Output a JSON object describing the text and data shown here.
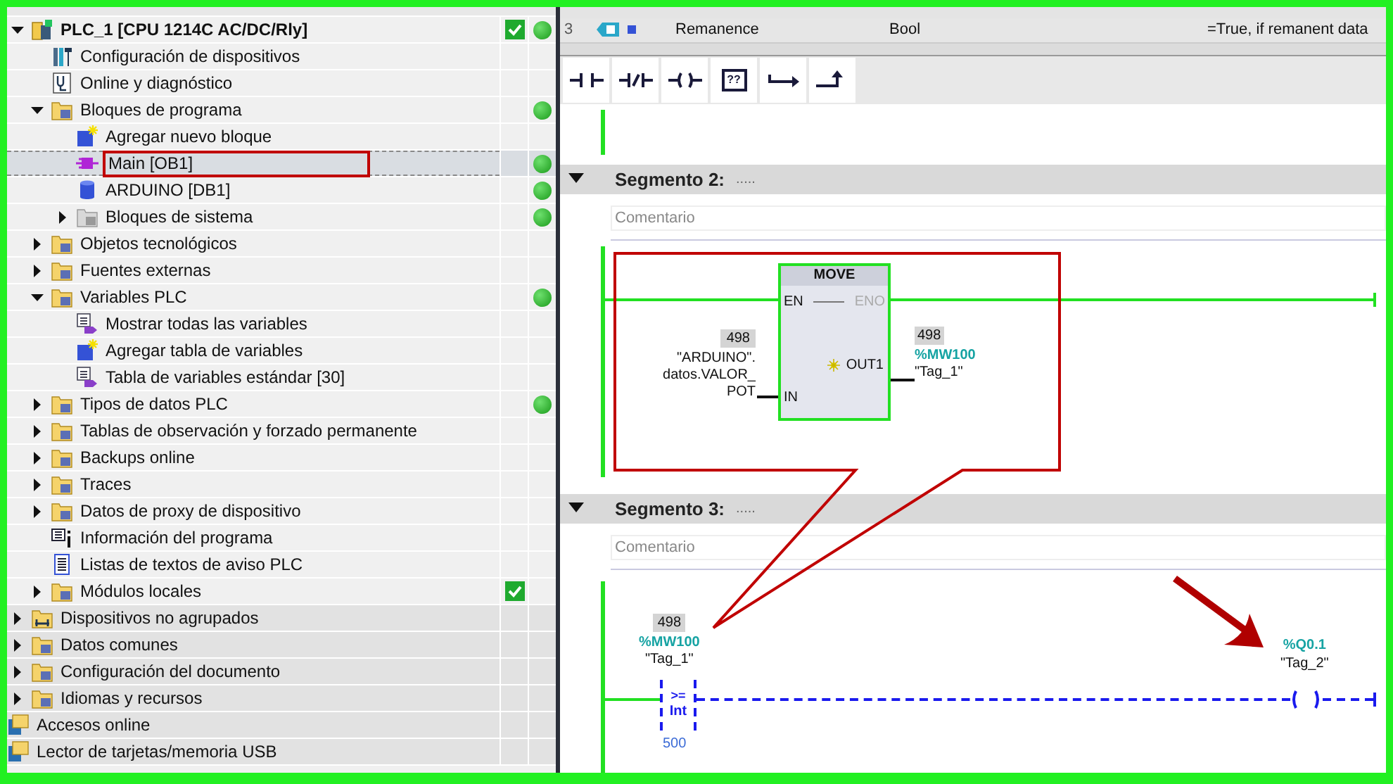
{
  "project_tree": [
    {
      "label": "PLC_1 [CPU 1214C AC/DC/Rly]",
      "kind": "device",
      "expanded": true,
      "selected": false,
      "ok": true,
      "online": true,
      "children": [
        {
          "label": "Configuración de dispositivos",
          "kind": "config",
          "selected": false
        },
        {
          "label": "Online y diagnóstico",
          "kind": "diagnostic",
          "selected": false
        },
        {
          "label": "Bloques de programa",
          "kind": "folder",
          "expanded": true,
          "selected": false,
          "online": true,
          "children": [
            {
              "label": "Agregar nuevo bloque",
              "kind": "add",
              "selected": false
            },
            {
              "label": "Main [OB1]",
              "kind": "block",
              "selected": true,
              "online": true
            },
            {
              "label": "ARDUINO [DB1]",
              "kind": "database",
              "selected": false,
              "online": true
            },
            {
              "label": "Bloques de sistema",
              "kind": "greyfolder",
              "expanded": false,
              "selected": false,
              "online": true
            }
          ]
        },
        {
          "label": "Objetos tecnológicos",
          "kind": "folder",
          "expanded": false,
          "selected": false
        },
        {
          "label": "Fuentes externas",
          "kind": "folder",
          "expanded": false,
          "selected": false
        },
        {
          "label": "Variables PLC",
          "kind": "folder",
          "expanded": true,
          "selected": false,
          "online": true,
          "children": [
            {
              "label": "Mostrar todas las variables",
              "kind": "tags",
              "selected": false
            },
            {
              "label": "Agregar tabla de variables",
              "kind": "add",
              "selected": false
            },
            {
              "label": "Tabla de variables estándar [30]",
              "kind": "tags",
              "selected": false
            }
          ]
        },
        {
          "label": "Tipos de datos PLC",
          "kind": "folder",
          "expanded": false,
          "selected": false,
          "online": true
        },
        {
          "label": "Tablas de observación y forzado permanente",
          "kind": "folder",
          "expanded": false,
          "selected": false
        },
        {
          "label": "Backups online",
          "kind": "folder",
          "expanded": false,
          "selected": false
        },
        {
          "label": "Traces",
          "kind": "folder",
          "expanded": false,
          "selected": false
        },
        {
          "label": "Datos de proxy de dispositivo",
          "kind": "folder",
          "expanded": false,
          "selected": false
        },
        {
          "label": "Información del programa",
          "kind": "info",
          "selected": false
        },
        {
          "label": "Listas de textos de aviso PLC",
          "kind": "textlist",
          "selected": false
        },
        {
          "label": "Módulos locales",
          "kind": "folder",
          "expanded": false,
          "selected": false,
          "ok": true
        }
      ]
    },
    {
      "label": "Dispositivos no agrupados",
      "kind": "network",
      "expanded": false,
      "selected": false
    },
    {
      "label": "Datos comunes",
      "kind": "folder",
      "expanded": false,
      "selected": false
    },
    {
      "label": "Configuración del documento",
      "kind": "folder",
      "expanded": false,
      "selected": false
    },
    {
      "label": "Idiomas y recursos",
      "kind": "folder",
      "expanded": false,
      "selected": false
    },
    {
      "label": "Accesos online",
      "kind": "reader",
      "selected": false
    },
    {
      "label": "Lector de tarjetas/memoria USB",
      "kind": "reader",
      "selected": false
    }
  ],
  "interface_row": {
    "number": "3",
    "name": "Remanence",
    "type": "Bool",
    "comment": "=True, if remanent data"
  },
  "toolbar": [
    {
      "kind": "no-contact"
    },
    {
      "kind": "nc-contact"
    },
    {
      "kind": "coil"
    },
    {
      "kind": "box",
      "label": "??"
    },
    {
      "kind": "jump"
    },
    {
      "kind": "branch"
    }
  ],
  "segments": [
    {
      "kind": "move",
      "title": "Segmento 2:",
      "dots": ".....",
      "placeholder": "Comentario",
      "box": {
        "title": "MOVE",
        "en": "EN",
        "eno": "ENO",
        "in_pin": "IN",
        "out_pin": "OUT1"
      },
      "input": {
        "value": "498",
        "operand": [
          "\"ARDUINO\".",
          "datos.VALOR_",
          "POT"
        ]
      },
      "output": {
        "value": "498",
        "address": "%MW100",
        "tag": "\"Tag_1\""
      }
    },
    {
      "kind": "compare",
      "title": "Segmento 3:",
      "dots": ".....",
      "placeholder": "Comentario",
      "operand": {
        "value": "498",
        "address": "%MW100",
        "tag": "\"Tag_1\""
      },
      "compare": {
        "op": ">=",
        "type": "Int",
        "operand2": "500"
      },
      "coil": {
        "address": "%Q0.1",
        "tag": "\"Tag_2\""
      }
    }
  ]
}
